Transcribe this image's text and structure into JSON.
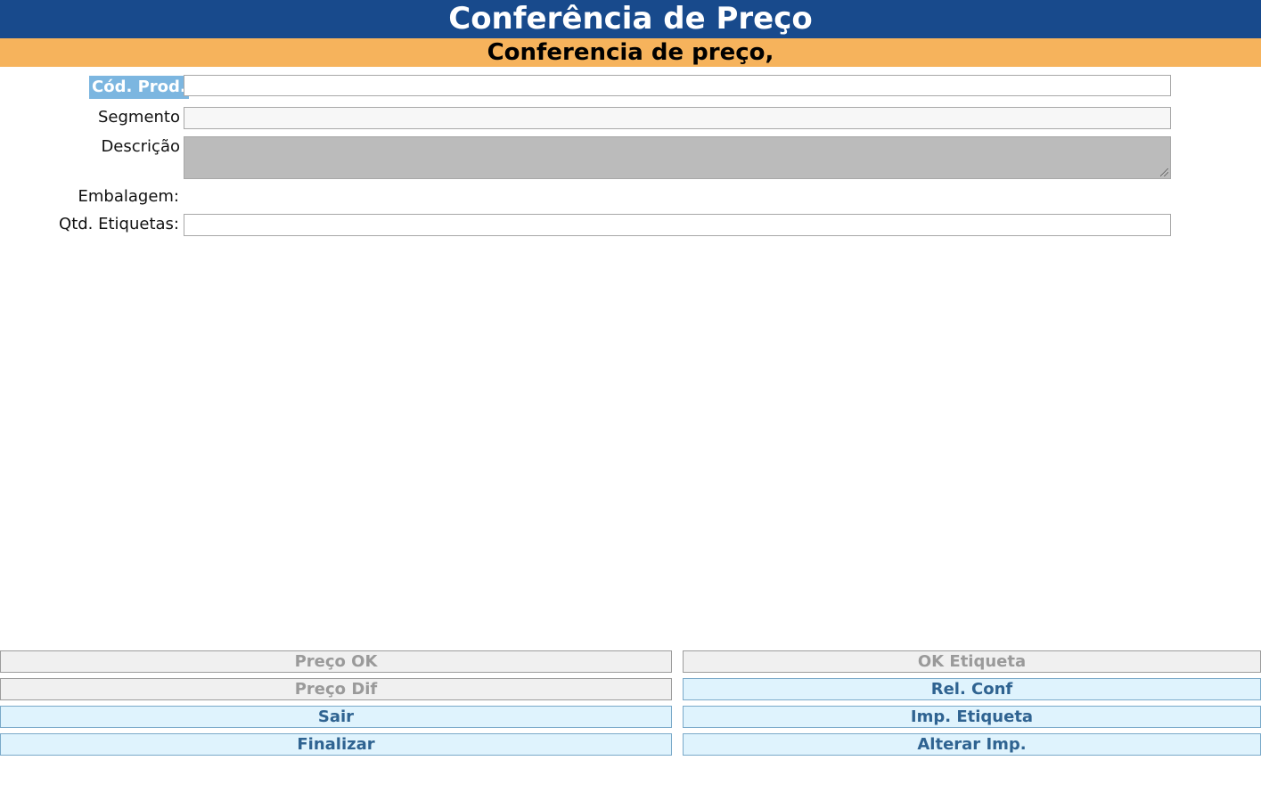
{
  "header": {
    "title": "Conferência de Preço",
    "subtitle": "Conferencia de preço,"
  },
  "form": {
    "cod_prod": {
      "label": "Cód. Prod.",
      "value": ""
    },
    "segmento": {
      "label": "Segmento",
      "value": ""
    },
    "descricao": {
      "label": "Descrição",
      "value": ""
    },
    "embalagem": {
      "label": "Embalagem:",
      "value": ""
    },
    "qtd_etiquetas": {
      "label": "Qtd. Etiquetas:",
      "value": ""
    }
  },
  "buttons": {
    "left": [
      {
        "label": "Preço OK",
        "enabled": false
      },
      {
        "label": "Preço Dif",
        "enabled": false
      },
      {
        "label": "Sair",
        "enabled": true
      },
      {
        "label": "Finalizar",
        "enabled": true
      }
    ],
    "right": [
      {
        "label": "OK Etiqueta",
        "enabled": false
      },
      {
        "label": "Rel. Conf",
        "enabled": true
      },
      {
        "label": "Imp. Etiqueta",
        "enabled": true
      },
      {
        "label": "Alterar Imp.",
        "enabled": true
      }
    ]
  },
  "colors": {
    "title_bg": "#184a8c",
    "subtitle_bg": "#f6b35c",
    "label_highlight": "#7cb6e0",
    "button_active_bg": "#dff3fd",
    "button_active_text": "#2f6391",
    "button_disabled_bg": "#f0f0f0",
    "button_disabled_text": "#9a9a9a"
  }
}
